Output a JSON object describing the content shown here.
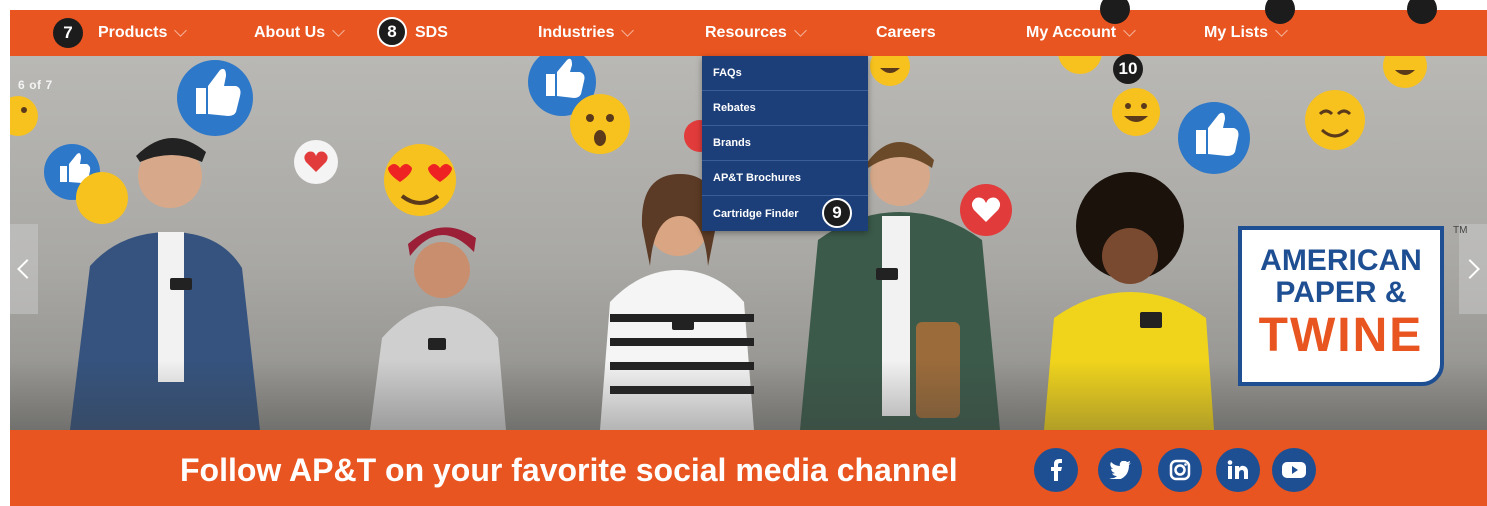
{
  "nav": {
    "items": [
      {
        "label": "Products",
        "has_dropdown": true
      },
      {
        "label": "About Us",
        "has_dropdown": true
      },
      {
        "label": "SDS",
        "has_dropdown": false
      },
      {
        "label": "Industries",
        "has_dropdown": true
      },
      {
        "label": "Resources",
        "has_dropdown": true
      },
      {
        "label": "Careers",
        "has_dropdown": false
      },
      {
        "label": "My Account",
        "has_dropdown": true
      },
      {
        "label": "My Lists",
        "has_dropdown": true
      }
    ]
  },
  "badges": {
    "products": "7",
    "sds": "8",
    "cartridge": "9",
    "account": "10"
  },
  "resources_menu": {
    "items": [
      "FAQs",
      "Rebates",
      "Brands",
      "AP&T Brochures",
      "Cartridge Finder"
    ]
  },
  "carousel": {
    "current": "6",
    "of": "of",
    "total": "7"
  },
  "logo": {
    "line1": "AMERICAN",
    "line2": "PAPER &",
    "line3": "TWINE",
    "tm": "TM"
  },
  "footer": {
    "text": "Follow AP&T on your favorite social media channel",
    "social": [
      {
        "name": "facebook-icon",
        "glyph": "f"
      },
      {
        "name": "twitter-icon",
        "glyph": "t"
      },
      {
        "name": "instagram-icon",
        "glyph": "ig"
      },
      {
        "name": "linkedin-icon",
        "glyph": "in"
      },
      {
        "name": "youtube-icon",
        "glyph": "yt"
      }
    ]
  },
  "colors": {
    "nav_orange": "#e85520",
    "dropdown_blue": "#1d3f79",
    "logo_blue": "#1f4f93",
    "logo_orange": "#e85520"
  }
}
